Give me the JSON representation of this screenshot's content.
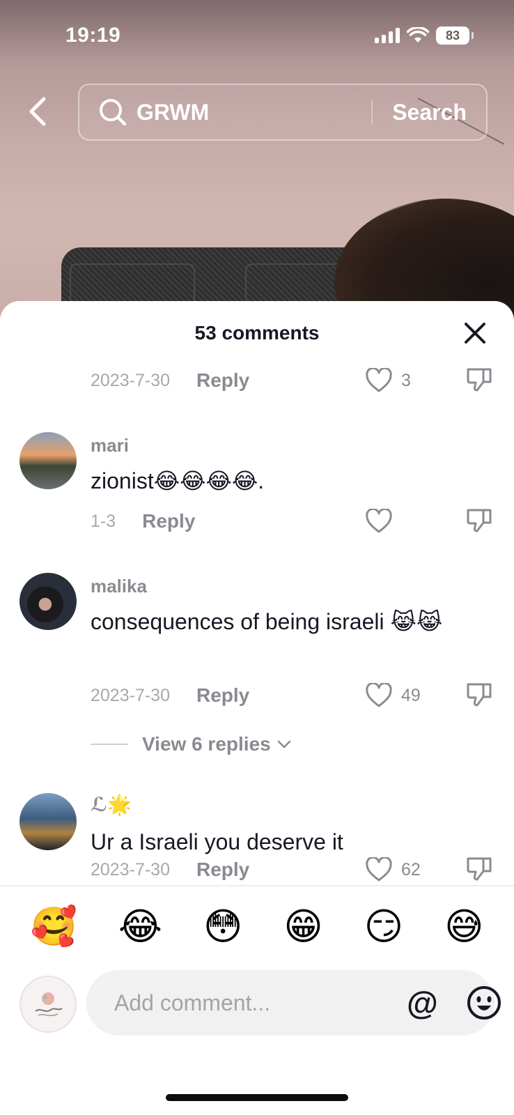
{
  "status_bar": {
    "time": "19:19",
    "battery": "83"
  },
  "search": {
    "query": "GRWM",
    "button_label": "Search"
  },
  "sheet": {
    "title": "53 comments"
  },
  "comments": [
    {
      "date": "2023-7-30",
      "reply_label": "Reply",
      "likes": "3"
    },
    {
      "username": "mari",
      "text": "zionist😂😂😂😂.",
      "date": "1-3",
      "reply_label": "Reply",
      "likes": ""
    },
    {
      "username": "malika",
      "text": "consequences of being israeli 😹😹",
      "date": "2023-7-30",
      "reply_label": "Reply",
      "likes": "49",
      "view_replies": "View 6 replies"
    },
    {
      "username": "ℒ🌟",
      "text": "Ur a Israeli you deserve it",
      "date": "2023-7-30",
      "reply_label": "Reply",
      "likes": "62"
    }
  ],
  "quick_emojis": [
    "🥰",
    "😂",
    "😳",
    "😁",
    "😏",
    "😅"
  ],
  "composer": {
    "placeholder": "Add comment...",
    "mention_label": "@"
  },
  "colors": {
    "accent_text": "#161823",
    "muted_text": "#8a8b91",
    "input_bg": "#f1f1f2"
  }
}
